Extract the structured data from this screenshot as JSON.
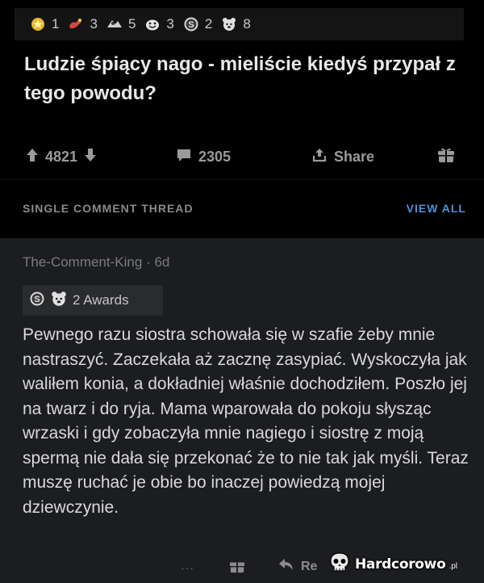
{
  "post": {
    "awards": [
      {
        "icon": "gold-medal-icon",
        "count": "1"
      },
      {
        "icon": "helping-hand-icon",
        "count": "3"
      },
      {
        "icon": "wholesome-icon",
        "count": "5"
      },
      {
        "icon": "laughing-face-icon",
        "count": "3"
      },
      {
        "icon": "silver-s-icon",
        "count": "2"
      },
      {
        "icon": "bear-icon",
        "count": "8"
      }
    ],
    "title": "Ludzie śpiący nago - mieliście kiedyś przypał z tego powodu?",
    "upvotes": "4821",
    "comments": "2305",
    "share_label": "Share"
  },
  "thread": {
    "header": "SINGLE COMMENT THREAD",
    "view_all": "VIEW ALL"
  },
  "comment": {
    "author": "The-Comment-King",
    "separator": "·",
    "age": "6d",
    "awards_label": "2 Awards",
    "body": "Pewnego razu siostra schowała się w szafie żeby mnie nastraszyć. Zaczekała aż zacznę zasypiać. Wyskoczyła jak waliłem konia, a dokładniej właśnie dochodziłem. Poszło jej na twarz i do ryja. Mama wparowała do pokoju słysząc wrzaski i gdy zobaczyła mnie nagiego i siostrę z moją spermą nie dała się przekonać że to nie tak jak myśli. Teraz muszę ruchać je obie bo inaczej powiedzą mojej dziewczynie.",
    "more_label": "···",
    "reply_label": "Re"
  },
  "watermark": {
    "text": "Hardcorowo",
    "suffix": ".pl"
  },
  "colors": {
    "background": "#000000",
    "comment_bg": "#1c1d21",
    "accent_link": "#4a90d9",
    "muted": "#8a8a8a"
  }
}
